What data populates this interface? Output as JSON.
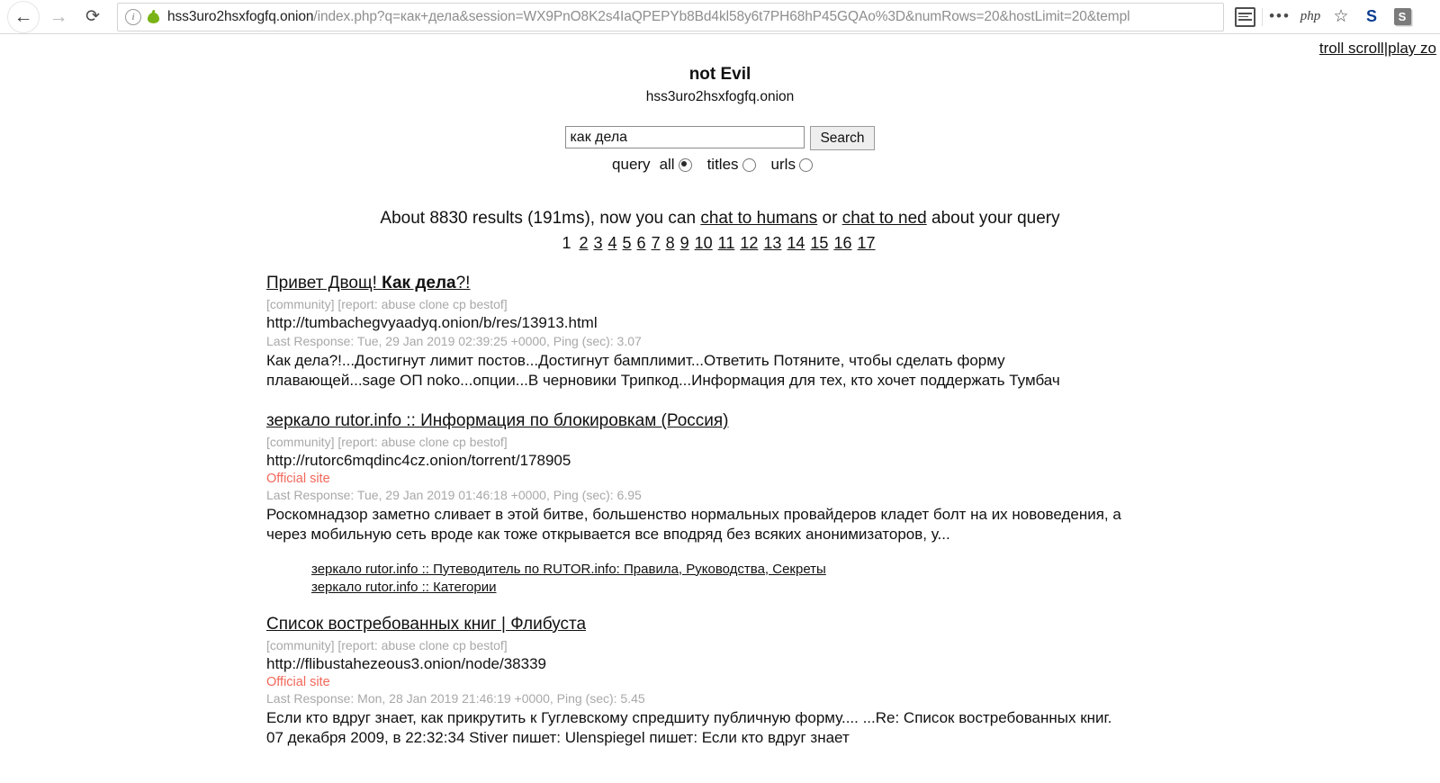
{
  "browser": {
    "back_icon": "back-arrow-icon",
    "forward_icon": "forward-arrow-icon",
    "reload_icon": "reload-icon",
    "info_icon": "ⓘ",
    "site_icon": "onion-icon",
    "url_host": "hss3uro2hsxfogfq.onion",
    "url_rest": "/index.php?q=как+дела&session=WX9PnO8K2s4IaQPEPYb8Bd4kl58y6t7PH68hP45GQAo%3D&numRows=20&hostLimit=20&templ",
    "toolbar": {
      "reader_icon": "reader-view-icon",
      "menu_dots": "•••",
      "php_label": "php",
      "star_icon": "☆",
      "ext_s_label": "S",
      "ext_sbox_label": "S"
    }
  },
  "page": {
    "top_links": {
      "troll_scroll": "troll scroll",
      "separator": "|",
      "play_zone": "play zo"
    },
    "brand": {
      "title": "not Evil",
      "subtitle": "hss3uro2hsxfogfq.onion"
    },
    "search": {
      "query_value": "как дела",
      "placeholder": "",
      "button_label": "Search",
      "scope_label": "query",
      "options": [
        {
          "label": "all",
          "selected": true
        },
        {
          "label": "titles",
          "selected": false
        },
        {
          "label": "urls",
          "selected": false
        }
      ]
    },
    "results_info": {
      "prefix": "About 8830 results (191ms), now you can ",
      "link1": "chat to humans",
      "middle": " or ",
      "link2": "chat to ned",
      "suffix": " about your query"
    },
    "pager": {
      "current": "1",
      "pages": [
        "2",
        "3",
        "4",
        "5",
        "6",
        "7",
        "8",
        "9",
        "10",
        "11",
        "12",
        "13",
        "14",
        "15",
        "16",
        "17"
      ]
    },
    "results": [
      {
        "title_plain_1": "Привет Двощ! ",
        "title_bold": "Как дела",
        "title_plain_2": "?!",
        "tags": "[community] [report: abuse clone cp bestof]",
        "url": "http://tumbachegvyaadyq.onion/b/res/13913.html",
        "official": "",
        "meta": "Last Response: Tue, 29 Jan 2019 02:39:25 +0000, Ping (sec): 3.07",
        "snippet": "Как дела?!...Достигнут лимит постов...Достигнут бамплимит...Ответить Потяните, чтобы сделать форму плавающей...sage ОП noko...опции...В черновики Трипкод...Информация для тех, кто хочет поддержать Тумбач",
        "sublinks": []
      },
      {
        "title_plain_1": "зеркало rutor.info :: Информация по блокировкам (Россия)",
        "title_bold": "",
        "title_plain_2": "",
        "tags": "[community] [report: abuse clone cp bestof]",
        "url": "http://rutorc6mqdinc4cz.onion/torrent/178905",
        "official": "Official site",
        "meta": "Last Response: Tue, 29 Jan 2019 01:46:18 +0000, Ping (sec): 6.95",
        "snippet": "Роскомнадзор заметно сливает в этой битве, большенство нормальных провайдеров кладет болт на их нововедения, а через мобильную сеть вроде как тоже открывается все вподряд без всяких анонимизаторов, у...",
        "sublinks": [
          "зеркало rutor.info :: Путеводитель по RUTOR.info: Правила, Руководства, Секреты",
          "зеркало rutor.info :: Категории"
        ]
      },
      {
        "title_plain_1": "Список востребованных книг | Флибуста",
        "title_bold": "",
        "title_plain_2": "",
        "tags": "[community] [report: abuse clone cp bestof]",
        "url": "http://flibustahezeous3.onion/node/38339",
        "official": "Official site",
        "meta": "Last Response: Mon, 28 Jan 2019 21:46:19 +0000, Ping (sec): 5.45",
        "snippet": "Если кто вдруг знает, как прикрутить к Гуглевскому спредшиту публичную форму.... ...Re: Список востребованных книг. 07 декабря 2009, в 22:32:34 Stiver пишет:   Ulenspiegel пишет:   Если кто вдруг знает",
        "sublinks": []
      }
    ]
  },
  "colors": {
    "official_site": "#f2675a",
    "muted_text": "#a8a8a8",
    "onion_green": "#7ab317",
    "ext_blue": "#0b3d91"
  }
}
